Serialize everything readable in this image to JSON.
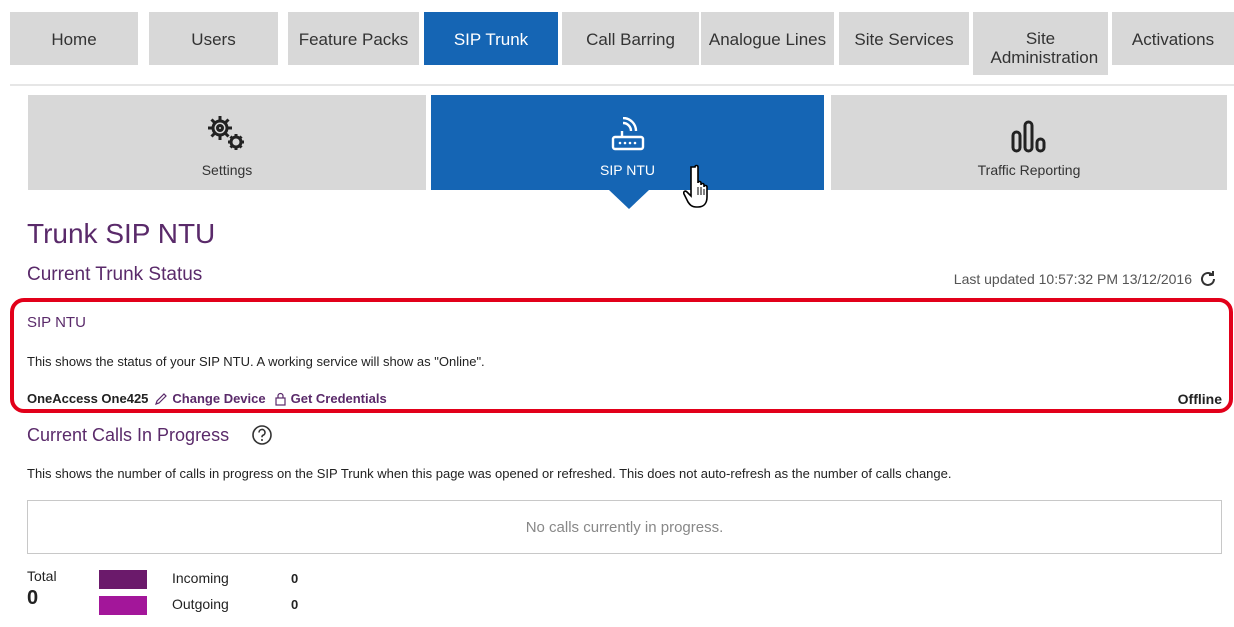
{
  "nav": {
    "tabs": [
      {
        "label": "Home"
      },
      {
        "label": "Users"
      },
      {
        "label": "Feature Packs"
      },
      {
        "label": "SIP Trunk"
      },
      {
        "label": "Call Barring"
      },
      {
        "label": "Analogue Lines"
      },
      {
        "label": "Site Services"
      },
      {
        "label": "Site Administration"
      },
      {
        "label": "Activations"
      }
    ],
    "active": "SIP Trunk"
  },
  "subnav": {
    "tabs": [
      {
        "label": "Settings",
        "icon": "gears-icon"
      },
      {
        "label": "SIP NTU",
        "icon": "router-icon"
      },
      {
        "label": "Traffic Reporting",
        "icon": "bar-chart-icon"
      }
    ],
    "active": "SIP NTU"
  },
  "page": {
    "title": "Trunk SIP NTU",
    "section_title": "Current Trunk Status",
    "last_updated": "Last updated 10:57:32 PM 13/12/2016"
  },
  "ntu": {
    "title": "SIP NTU",
    "description": "This shows the status of your SIP NTU. A working service will show as \"Online\".",
    "device": "OneAccess One425",
    "change_device": "Change Device",
    "get_credentials": "Get Credentials",
    "status": "Offline"
  },
  "calls": {
    "title": "Current Calls In Progress",
    "description": "This shows the number of calls in progress on the SIP Trunk when this page was opened or refreshed. This does not auto-refresh as the number of calls change.",
    "empty_message": "No calls currently in progress.",
    "total_label": "Total",
    "total_value": "0",
    "incoming_label": "Incoming",
    "incoming_value": "0",
    "outgoing_label": "Outgoing",
    "outgoing_value": "0"
  },
  "colors": {
    "accent_blue": "#1565b4",
    "brand_purple": "#5a2a6a",
    "incoming": "#6b1a6b",
    "outgoing": "#a3169a",
    "highlight_red": "#e2001a"
  }
}
